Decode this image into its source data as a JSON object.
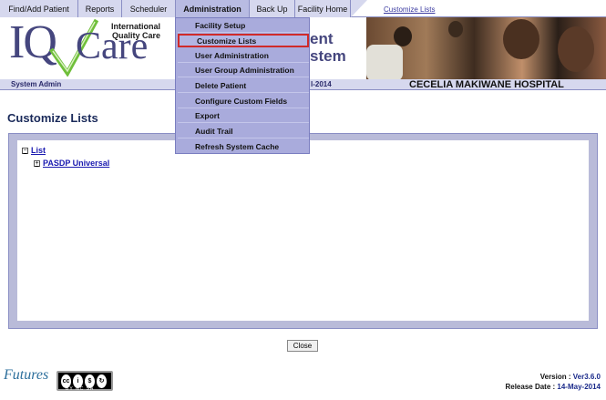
{
  "menu": {
    "tabs": [
      {
        "label": "Find/Add Patient"
      },
      {
        "label": "Reports"
      },
      {
        "label": "Scheduler"
      },
      {
        "label": "Administration"
      },
      {
        "label": "Back Up"
      },
      {
        "label": "Facility Home"
      }
    ],
    "breadcrumb": "Customize Lists"
  },
  "banner": {
    "logo_iq": "IQ",
    "logo_care": "Care",
    "logo_tag_line1": "International",
    "logo_tag_line2": "Quality Care",
    "tagline_line1": "ent",
    "tagline_line2": "stem"
  },
  "status": {
    "user": "System Admin",
    "date_fragment": "l-2014",
    "hospital": "CECELIA MAKIWANE HOSPITAL"
  },
  "dropdown": {
    "items": [
      {
        "label": "Facility Setup"
      },
      {
        "label": "Customize Lists"
      },
      {
        "label": "User Administration"
      },
      {
        "label": "User Group Administration"
      },
      {
        "label": "Delete Patient"
      },
      {
        "label": "Configure Custom Fields"
      },
      {
        "label": "Export"
      },
      {
        "label": "Audit Trail"
      },
      {
        "label": "Refresh System Cache"
      }
    ],
    "selected": "Customize Lists"
  },
  "page": {
    "title": "Customize Lists",
    "tree": {
      "root": {
        "label": "List",
        "expander": "−"
      },
      "child": {
        "label": "PASDP Universal",
        "expander": "+"
      }
    },
    "close_label": "Close"
  },
  "footer": {
    "futures_logo": "Futures",
    "cc_labels": "BY NC SA",
    "version_label": "Version :",
    "version_value": "Ver3.6.0",
    "release_label": "Release Date :",
    "release_value": "14-May-2014"
  },
  "colors": {
    "menu_bg": "#d6d8ee",
    "dropdown_bg": "#a9abdc",
    "selected_border": "#d02a2a",
    "logo_color": "#45467e"
  }
}
